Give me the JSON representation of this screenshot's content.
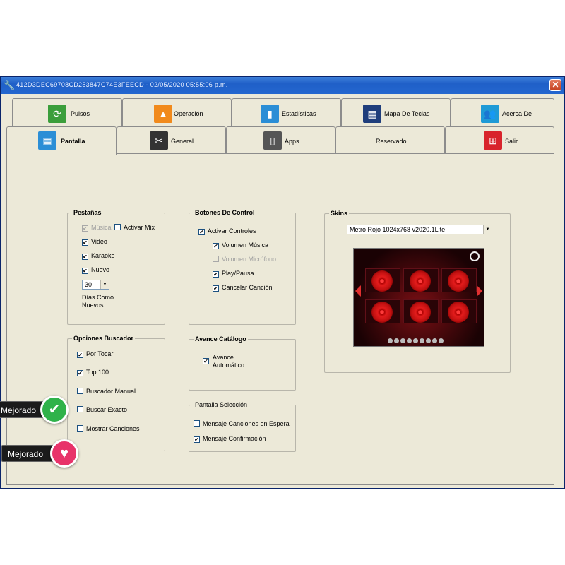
{
  "window": {
    "title": "412D3DEC69708CD253847C74E3FEECD - 02/05/2020 05:55:06 p.m.",
    "close_label": "✕"
  },
  "tabs_row1": [
    {
      "label": "Pulsos",
      "icon": "pulse-icon",
      "color": "#3b9e3b"
    },
    {
      "label": "Operación",
      "icon": "vlc-cone-icon",
      "color": "#f18a1c"
    },
    {
      "label": "Estadísticas",
      "icon": "bar-chart-icon",
      "color": "#2b8ed6"
    },
    {
      "label": "Mapa De Teclas",
      "icon": "keyboard-map-icon",
      "color": "#1f3e7c"
    },
    {
      "label": "Acerca De",
      "icon": "users-icon",
      "color": "#1e9ad6"
    }
  ],
  "tabs_row2": [
    {
      "label": "Pantalla",
      "icon": "grid-icon",
      "color": "#2b8ed6",
      "active": true
    },
    {
      "label": "General",
      "icon": "tools-icon",
      "color": "#333333"
    },
    {
      "label": "Apps",
      "icon": "phone-icon",
      "color": "#555555"
    },
    {
      "label": "Reservado",
      "icon": "",
      "color": ""
    },
    {
      "label": "Salir",
      "icon": "exit-icon",
      "color": "#d8242c"
    }
  ],
  "pestanas": {
    "title": "Pestañas",
    "musica": {
      "label": "Música",
      "checked": true,
      "disabled": true
    },
    "activar_mix": {
      "label": "Activar Mix",
      "checked": false
    },
    "video": {
      "label": "Video",
      "checked": true
    },
    "karaoke": {
      "label": "Karaoke",
      "checked": true
    },
    "nuevo": {
      "label": "Nuevo",
      "checked": true
    },
    "dias_value": "30",
    "dias_label_1": "Días Como",
    "dias_label_2": "Nuevos"
  },
  "opciones_buscador": {
    "title": "Opciones Buscador",
    "por_tocar": {
      "label": "Por Tocar",
      "checked": true
    },
    "top_100": {
      "label": "Top 100",
      "checked": true
    },
    "buscador_manual": {
      "label": "Buscador Manual",
      "checked": false
    },
    "buscar_exacto": {
      "label": "Buscar Exacto",
      "checked": false
    },
    "mostrar_canciones": {
      "label": "Mostrar Canciones",
      "checked": false
    }
  },
  "botones_control": {
    "title": "Botones De Control",
    "activar_controles": {
      "label": "Activar Controles",
      "checked": true
    },
    "volumen_musica": {
      "label": "Volumen Música",
      "checked": true
    },
    "volumen_microfono": {
      "label": "Volumen Micrófono",
      "checked": false,
      "disabled": true
    },
    "play_pausa": {
      "label": "Play/Pausa",
      "checked": true
    },
    "cancelar_cancion": {
      "label": "Cancelar Canción",
      "checked": true
    }
  },
  "avance_catalogo": {
    "title": "Avance Catálogo",
    "avance_line1": "Avance",
    "avance_line2": "Automático",
    "checked": true
  },
  "pantalla_seleccion": {
    "title": "Pantalla Selección",
    "mensaje_espera": {
      "label": "Mensaje Canciones en Espera",
      "checked": false
    },
    "mensaje_confirmacion": {
      "label": "Mensaje Confirmación",
      "checked": true
    }
  },
  "skins": {
    "title": "Skins",
    "selected": "Metro Rojo 1024x768 v2020.1Lite"
  },
  "badges": {
    "mejorado_1": "Mejorado",
    "mejorado_2": "Mejorado",
    "green": "#2fb24a",
    "pink": "#e8336a"
  },
  "check_glyph": "✔"
}
